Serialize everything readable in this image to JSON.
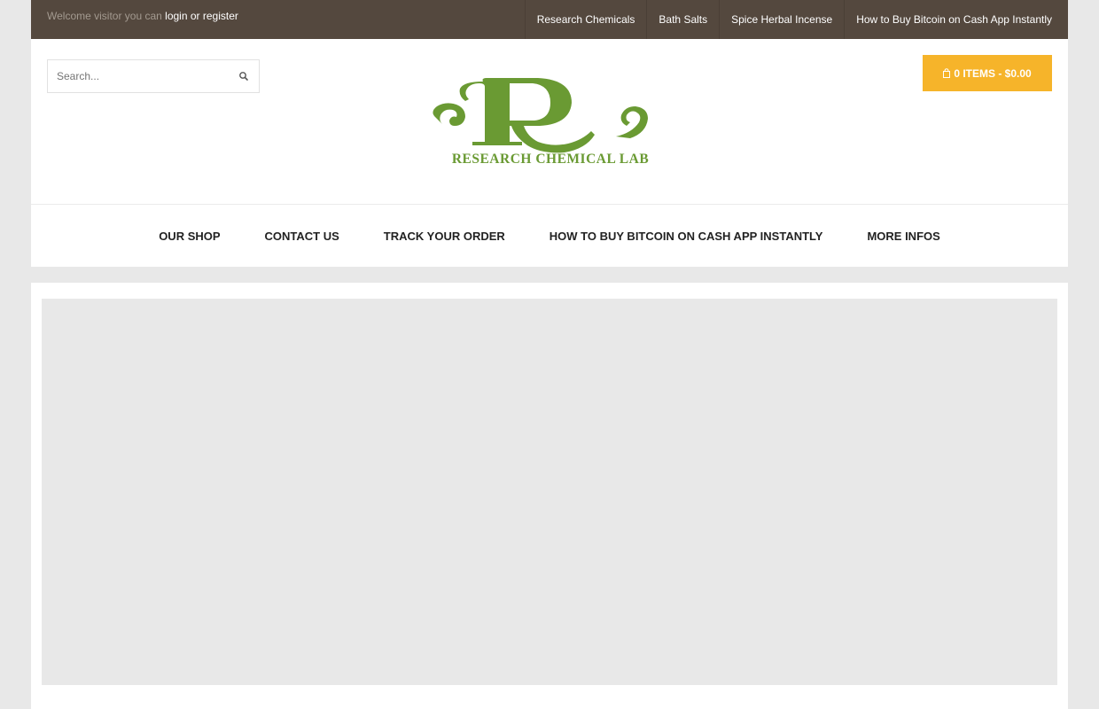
{
  "topbar": {
    "welcome_text": "Welcome visitor you can",
    "login_label": "login",
    "or_text": "or",
    "register_label": "register",
    "links": [
      "Research Chemicals",
      "Bath Salts",
      "Spice Herbal Incense",
      "How to Buy Bitcoin on Cash App Instantly"
    ]
  },
  "search": {
    "placeholder": "Search...",
    "icon": "search-icon"
  },
  "cart": {
    "label": "0 ITEMS - $0.00",
    "icon": "shopping-bag-icon"
  },
  "logo": {
    "text": "RESEARCH CHEMICAL LAB",
    "monogram": "R"
  },
  "nav": {
    "items": [
      "OUR SHOP",
      "CONTACT US",
      "TRACK YOUR ORDER",
      "HOW TO BUY BITCOIN ON CASH APP INSTANTLY",
      "MORE INFOS"
    ]
  },
  "colors": {
    "topbar": "#54483e",
    "accent": "#f6b42a",
    "logo_green": "#6a9a33",
    "page_bg": "#e8e8e8"
  }
}
